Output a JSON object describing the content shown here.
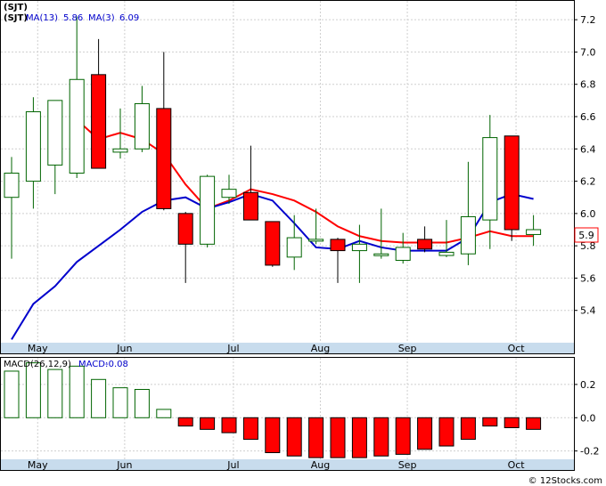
{
  "legend": {
    "ticker": "(SJT)",
    "ma13_label": "MA(13)",
    "ma13_value": "5.86",
    "ma3_label": "MA(3)",
    "ma3_value": "6.09",
    "macd_label": "MACD(26,12,9)",
    "macd_name": "MACD:",
    "macd_value": "-0.08"
  },
  "last_price_badge": "5.9",
  "footer": {
    "watermark": "© 12Stocks.com"
  },
  "colors": {
    "up": "#006400",
    "down": "#ff0000",
    "ma13": "#ff0000",
    "ma3": "#0000cc",
    "grid": "#cfcfcf",
    "axis_band": "#c8dced",
    "legend_text": "#0000cc"
  },
  "chart_data": [
    {
      "type": "candlestick",
      "title": "(SJT)",
      "x_labels": [
        "May",
        "Jun",
        "Jul",
        "Aug",
        "Sep",
        "Oct"
      ],
      "x_label_positions": [
        1.2,
        5.2,
        10.2,
        14.2,
        18.2,
        23.2
      ],
      "y_ticks": [
        5.4,
        5.6,
        5.8,
        6.0,
        6.2,
        6.4,
        6.6,
        6.8,
        7.0,
        7.2
      ],
      "ylim": [
        5.2,
        7.3
      ],
      "grid": true,
      "candles": [
        {
          "o": 6.1,
          "h": 6.35,
          "l": 5.72,
          "c": 6.25
        },
        {
          "o": 6.2,
          "h": 6.72,
          "l": 6.03,
          "c": 6.63
        },
        {
          "o": 6.3,
          "h": 6.7,
          "l": 6.12,
          "c": 6.7
        },
        {
          "o": 6.25,
          "h": 7.22,
          "l": 6.22,
          "c": 6.83
        },
        {
          "o": 6.86,
          "h": 7.08,
          "l": 6.28,
          "c": 6.28
        },
        {
          "o": 6.38,
          "h": 6.65,
          "l": 6.34,
          "c": 6.4
        },
        {
          "o": 6.4,
          "h": 6.79,
          "l": 6.38,
          "c": 6.68
        },
        {
          "o": 6.65,
          "h": 7.0,
          "l": 6.02,
          "c": 6.03
        },
        {
          "o": 6.0,
          "h": 6.01,
          "l": 5.57,
          "c": 5.81
        },
        {
          "o": 5.81,
          "h": 6.24,
          "l": 5.79,
          "c": 6.23
        },
        {
          "o": 6.1,
          "h": 6.24,
          "l": 6.06,
          "c": 6.15
        },
        {
          "o": 6.13,
          "h": 6.42,
          "l": 5.97,
          "c": 5.96
        },
        {
          "o": 5.95,
          "h": 5.95,
          "l": 5.67,
          "c": 5.68
        },
        {
          "o": 5.73,
          "h": 5.99,
          "l": 5.65,
          "c": 5.85
        },
        {
          "o": 5.83,
          "h": 6.03,
          "l": 5.81,
          "c": 5.84
        },
        {
          "o": 5.84,
          "h": 5.85,
          "l": 5.57,
          "c": 5.77
        },
        {
          "o": 5.77,
          "h": 5.93,
          "l": 5.57,
          "c": 5.81
        },
        {
          "o": 5.74,
          "h": 6.03,
          "l": 5.72,
          "c": 5.75
        },
        {
          "o": 5.71,
          "h": 5.88,
          "l": 5.69,
          "c": 5.79
        },
        {
          "o": 5.84,
          "h": 5.92,
          "l": 5.76,
          "c": 5.78
        },
        {
          "o": 5.74,
          "h": 5.96,
          "l": 5.73,
          "c": 5.76
        },
        {
          "o": 5.75,
          "h": 6.32,
          "l": 5.68,
          "c": 5.98
        },
        {
          "o": 5.96,
          "h": 6.61,
          "l": 5.78,
          "c": 6.47
        },
        {
          "o": 6.48,
          "h": 6.48,
          "l": 5.83,
          "c": 5.9
        },
        {
          "o": 5.87,
          "h": 5.99,
          "l": 5.8,
          "c": 5.9
        }
      ],
      "series": [
        {
          "name": "MA(13)",
          "color": "#ff0000",
          "x": [
            3,
            4,
            5,
            6,
            7,
            8,
            9,
            10,
            11,
            12,
            13,
            14,
            15,
            16,
            17,
            18,
            19,
            20,
            21,
            22,
            23,
            24
          ],
          "values": [
            6.58,
            6.46,
            6.5,
            6.46,
            6.37,
            6.18,
            6.03,
            6.08,
            6.15,
            6.12,
            6.08,
            6.01,
            5.92,
            5.86,
            5.83,
            5.82,
            5.82,
            5.82,
            5.85,
            5.89,
            5.86,
            5.86
          ]
        },
        {
          "name": "MA(3)",
          "color": "#0000cc",
          "x": [
            0,
            1,
            2,
            3,
            4,
            5,
            6,
            7,
            8,
            9,
            10,
            11,
            12,
            13,
            14,
            15,
            16,
            17,
            18,
            19,
            20,
            21,
            22,
            23,
            24
          ],
          "values": [
            5.22,
            5.44,
            5.55,
            5.7,
            5.8,
            5.9,
            6.01,
            6.08,
            6.1,
            6.03,
            6.07,
            6.12,
            6.08,
            5.94,
            5.79,
            5.78,
            5.83,
            5.79,
            5.77,
            5.77,
            5.77,
            5.85,
            6.07,
            6.12,
            6.09
          ]
        }
      ]
    },
    {
      "type": "bar",
      "title": "MACD(26,12,9)",
      "y_ticks": [
        -0.2,
        0.0,
        0.2
      ],
      "ylim": [
        -0.25,
        0.36
      ],
      "grid": true,
      "values": [
        0.28,
        0.33,
        0.29,
        0.31,
        0.23,
        0.18,
        0.17,
        0.05,
        -0.05,
        -0.07,
        -0.09,
        -0.13,
        -0.21,
        -0.23,
        -0.24,
        -0.24,
        -0.24,
        -0.23,
        -0.22,
        -0.19,
        -0.17,
        -0.13,
        -0.05,
        -0.06,
        -0.07
      ]
    }
  ]
}
